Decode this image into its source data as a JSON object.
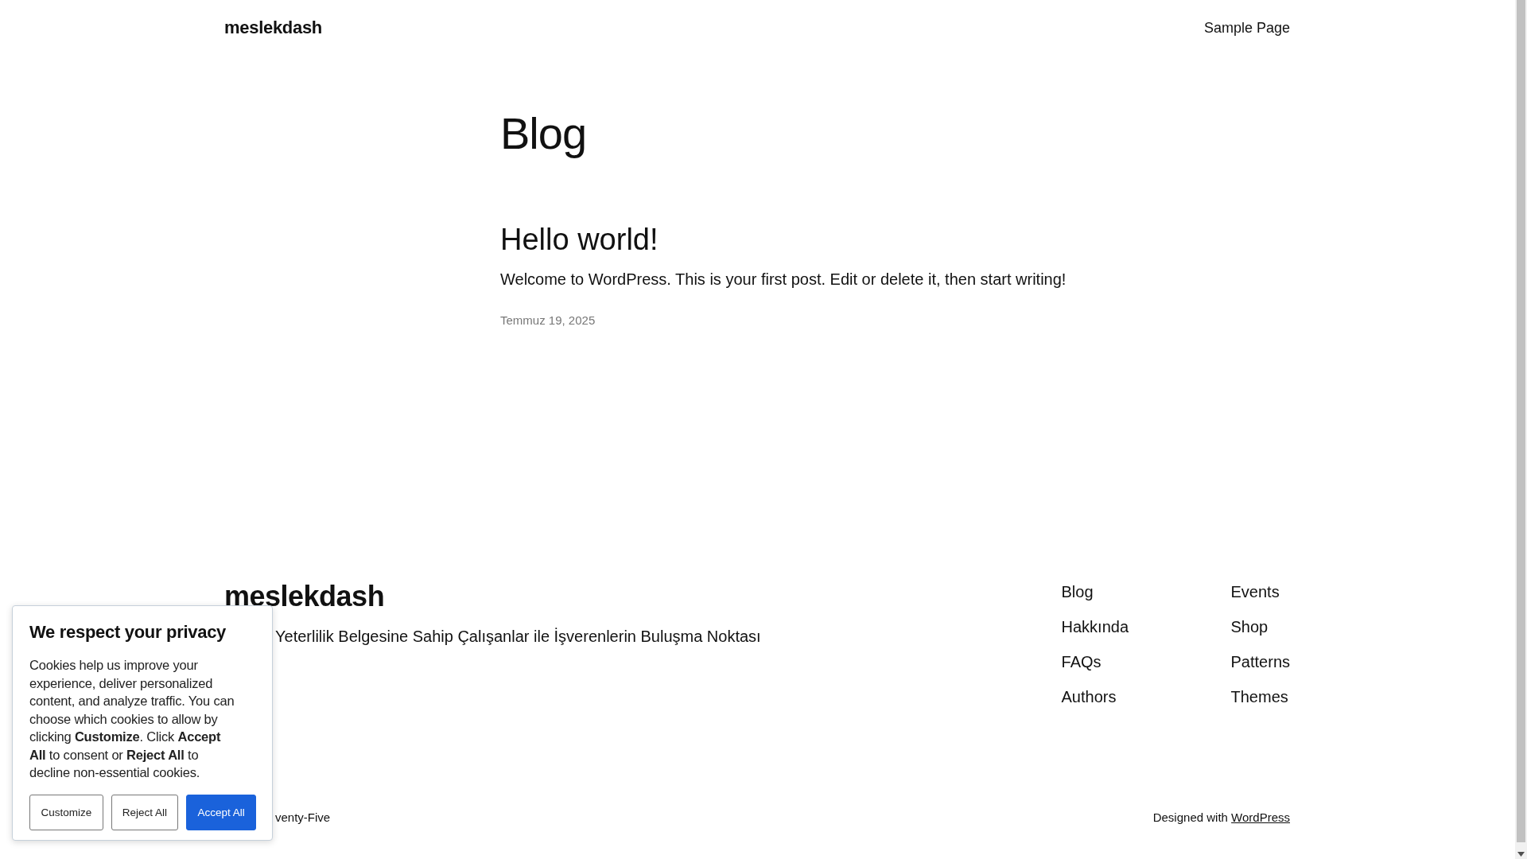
{
  "header": {
    "site_title": "meslekdash",
    "nav": [
      "Sample Page"
    ]
  },
  "page_title": "Blog",
  "posts": [
    {
      "title": "Hello world!",
      "excerpt": "Welcome to WordPress. This is your first post. Edit or delete it, then start writing!",
      "date": "Temmuz 19, 2025"
    }
  ],
  "footer": {
    "site_title": "meslekdash",
    "tagline": "Yeterlilik Belgesine Sahip Çalışanlar ile İşverenlerin Buluşma Noktası",
    "nav_columns": [
      [
        "Blog",
        "Hakkında",
        "FAQs",
        "Authors"
      ],
      [
        "Events",
        "Shop",
        "Patterns",
        "Themes"
      ]
    ],
    "credit": "venty-Five",
    "designed_with": "Designed with",
    "designed_link": "WordPress"
  },
  "cookie_banner": {
    "title": "We respect your privacy",
    "message": "Cookies help us improve your experience, deliver personalized content, and analyze traffic. You can choose which cookies to allow by clicking **Customize**. Click **Accept All** to consent or **Reject All** to decline non-essential cookies.",
    "buttons": [
      {
        "label": "Customize",
        "kind": "outline"
      },
      {
        "label": "Reject All",
        "kind": "outline"
      },
      {
        "label": "Accept All",
        "kind": "primary"
      }
    ]
  }
}
